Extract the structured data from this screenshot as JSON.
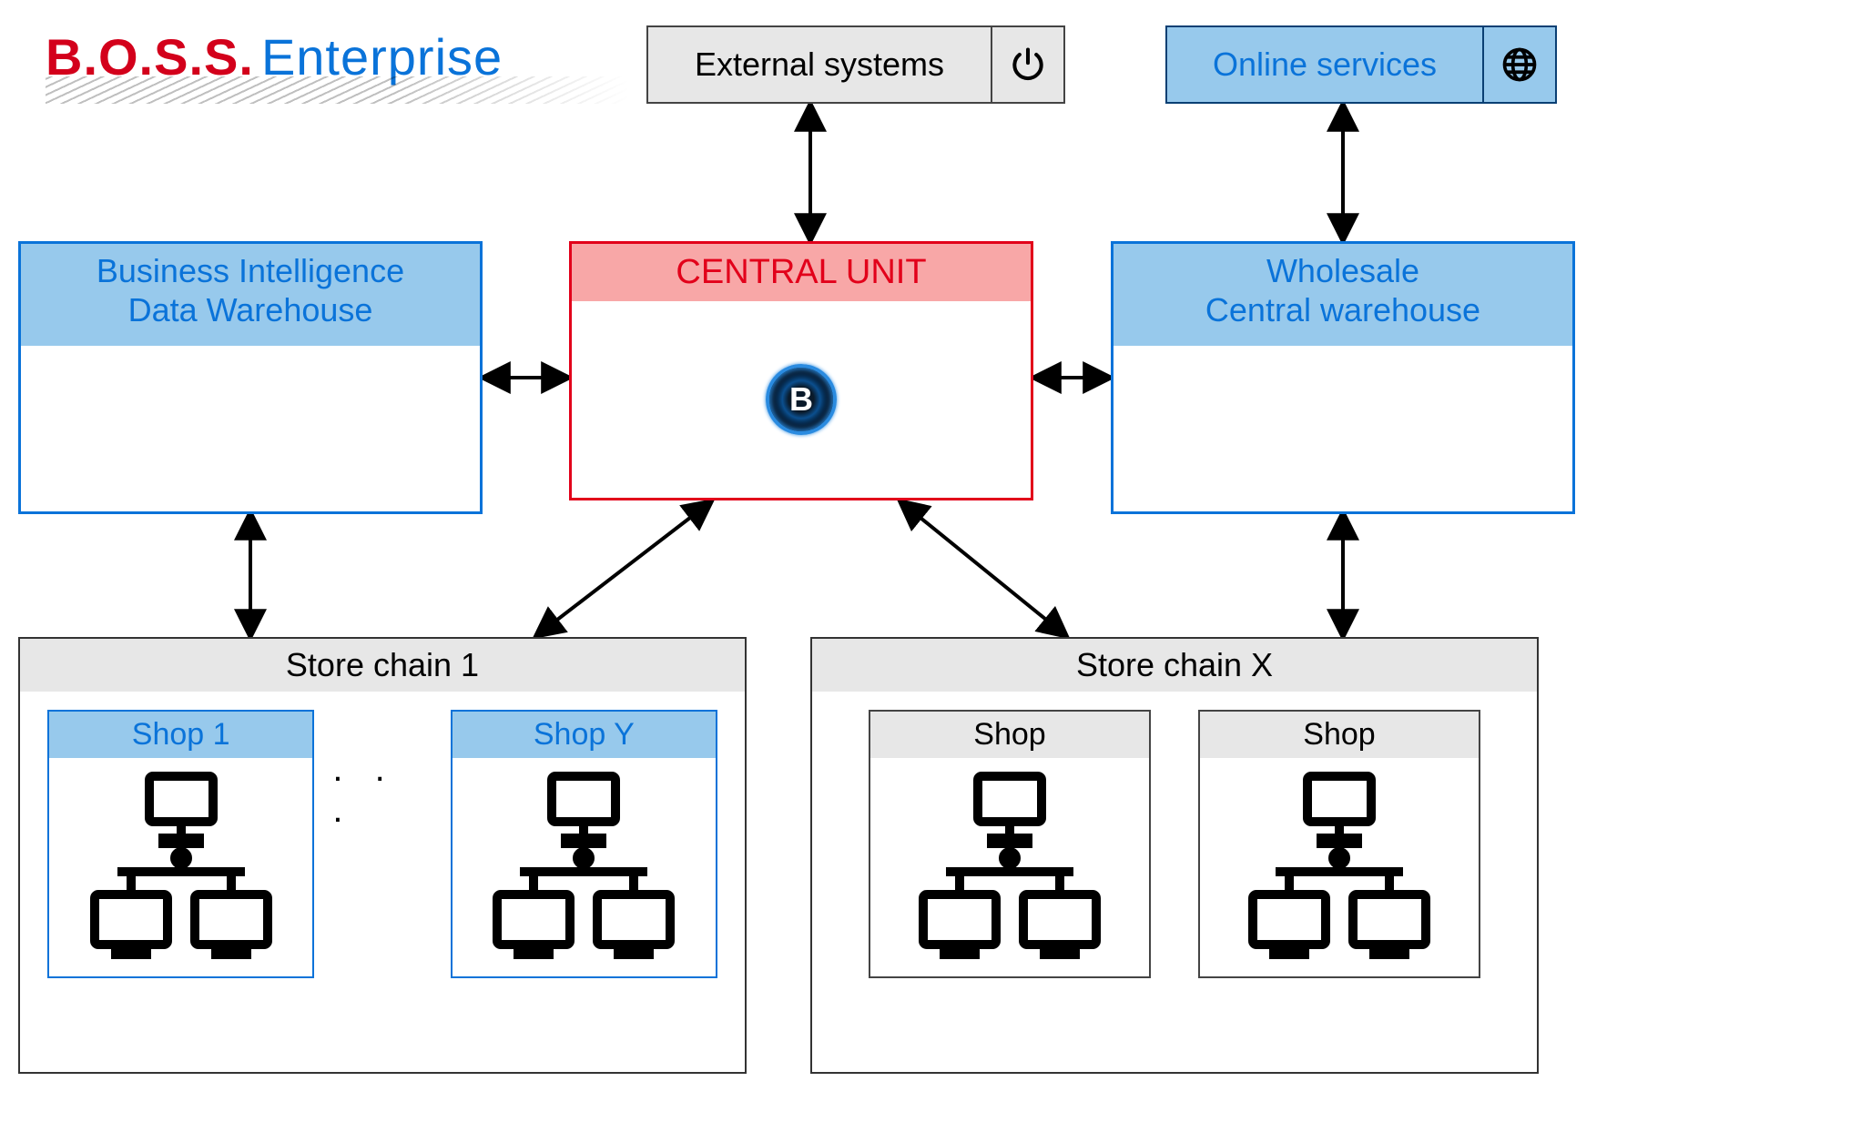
{
  "logo": {
    "boss": "B.O.S.S.",
    "enterprise": "Enterprise"
  },
  "top": {
    "external_systems": "External systems",
    "online_services": "Online services"
  },
  "bi": {
    "line1": "Business Intelligence",
    "line2": "Data Warehouse"
  },
  "central": {
    "title": "CENTRAL UNIT",
    "badge_letter": "B"
  },
  "wholesale": {
    "line1": "Wholesale",
    "line2": "Central warehouse"
  },
  "chains": {
    "chain1": {
      "title": "Store chain 1",
      "shop1": "Shop 1",
      "shop2": "Shop Y",
      "ellipsis": ". . ."
    },
    "chain2": {
      "title": "Store chain X",
      "shop1": "Shop",
      "shop2": "Shop"
    }
  },
  "colors": {
    "blue": "#0a73d9",
    "lightblue": "#97c9ec",
    "red": "#e2001a",
    "lightred": "#f8a7a7",
    "gray": "#e7e7e7"
  }
}
